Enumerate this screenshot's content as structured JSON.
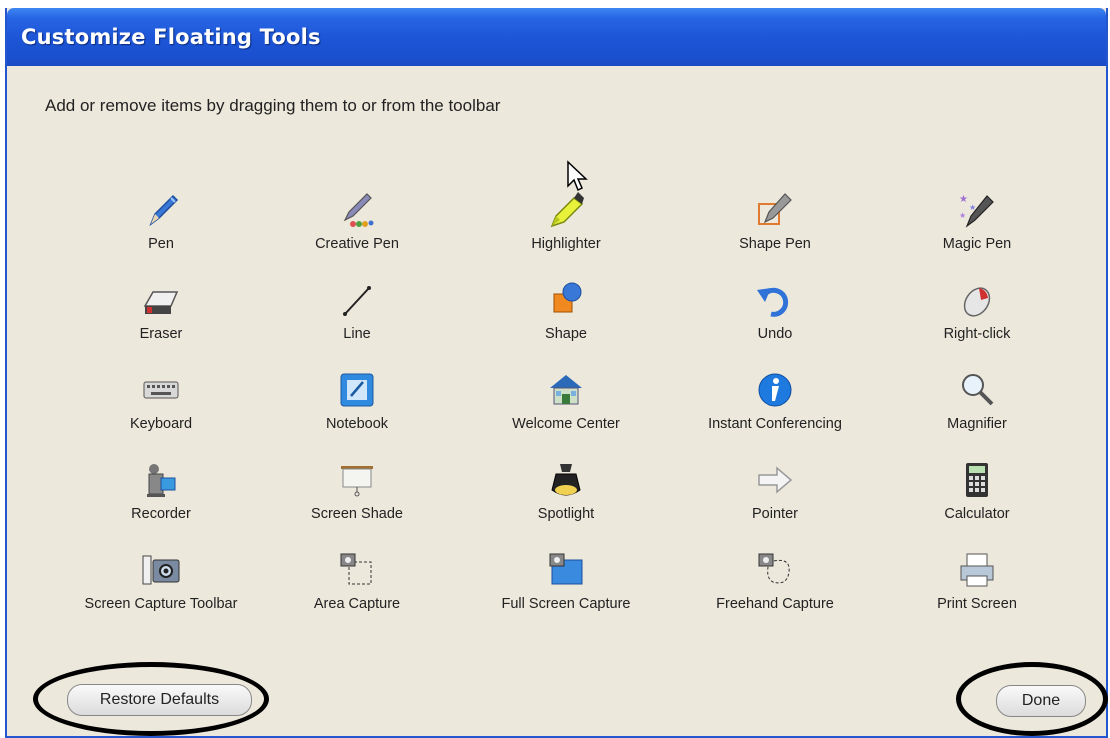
{
  "window": {
    "title": "Customize Floating Tools"
  },
  "instructions": "Add or remove items by dragging them to or from the toolbar",
  "tools": [
    {
      "label": "Pen",
      "icon": "pen-icon"
    },
    {
      "label": "Creative Pen",
      "icon": "creative-pen-icon"
    },
    {
      "label": "Highlighter",
      "icon": "highlighter-icon"
    },
    {
      "label": "Shape Pen",
      "icon": "shape-pen-icon"
    },
    {
      "label": "Magic Pen",
      "icon": "magic-pen-icon"
    },
    {
      "label": "Eraser",
      "icon": "eraser-icon"
    },
    {
      "label": "Line",
      "icon": "line-icon"
    },
    {
      "label": "Shape",
      "icon": "shape-icon"
    },
    {
      "label": "Undo",
      "icon": "undo-icon"
    },
    {
      "label": "Right-click",
      "icon": "mouse-icon"
    },
    {
      "label": "Keyboard",
      "icon": "keyboard-icon"
    },
    {
      "label": "Notebook",
      "icon": "notebook-icon"
    },
    {
      "label": "Welcome Center",
      "icon": "welcome-center-icon"
    },
    {
      "label": "Instant Conferencing",
      "icon": "conferencing-icon"
    },
    {
      "label": "Magnifier",
      "icon": "magnifier-icon"
    },
    {
      "label": "Recorder",
      "icon": "recorder-icon"
    },
    {
      "label": "Screen Shade",
      "icon": "screen-shade-icon"
    },
    {
      "label": "Spotlight",
      "icon": "spotlight-icon"
    },
    {
      "label": "Pointer",
      "icon": "pointer-arrow-icon"
    },
    {
      "label": "Calculator",
      "icon": "calculator-icon"
    },
    {
      "label": "Screen Capture Toolbar",
      "icon": "screen-capture-toolbar-icon"
    },
    {
      "label": "Area Capture",
      "icon": "area-capture-icon"
    },
    {
      "label": "Full Screen Capture",
      "icon": "full-screen-capture-icon"
    },
    {
      "label": "Freehand Capture",
      "icon": "freehand-capture-icon"
    },
    {
      "label": "Print Screen",
      "icon": "printer-icon"
    }
  ],
  "buttons": {
    "restore_defaults": "Restore Defaults",
    "done": "Done"
  },
  "colors": {
    "titlebar": "#2764e3",
    "background": "#ede8dc",
    "annotation_ring": "#000000"
  }
}
